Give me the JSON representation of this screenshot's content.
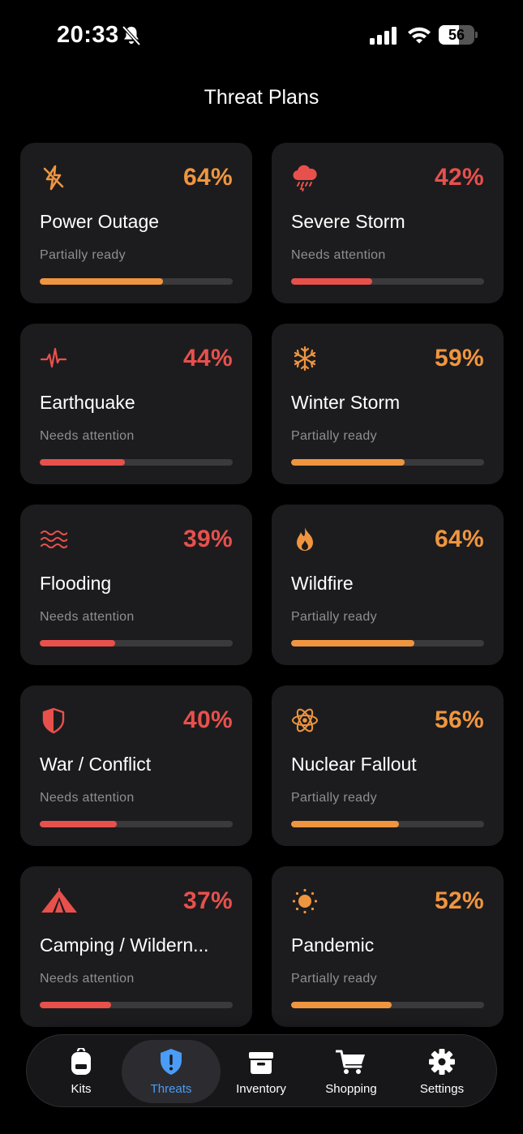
{
  "status_bar": {
    "time": "20:33",
    "battery": "56",
    "battery_level": 0.56
  },
  "page": {
    "title": "Threat Plans"
  },
  "colors": {
    "orange": "#f0953f",
    "red": "#e8504c",
    "active_tab": "#4a9cf6"
  },
  "threats": [
    {
      "icon": "lightning-slash-icon",
      "name": "Power Outage",
      "percent": "64%",
      "level": 0.64,
      "status": "Partially ready",
      "color": "orange"
    },
    {
      "icon": "cloud-storm-icon",
      "name": "Severe Storm",
      "percent": "42%",
      "level": 0.42,
      "status": "Needs attention",
      "color": "red"
    },
    {
      "icon": "waveform-icon",
      "name": "Earthquake",
      "percent": "44%",
      "level": 0.44,
      "status": "Needs attention",
      "color": "red"
    },
    {
      "icon": "snowflake-icon",
      "name": "Winter Storm",
      "percent": "59%",
      "level": 0.59,
      "status": "Partially ready",
      "color": "orange"
    },
    {
      "icon": "water-waves-icon",
      "name": "Flooding",
      "percent": "39%",
      "level": 0.39,
      "status": "Needs attention",
      "color": "red"
    },
    {
      "icon": "flame-icon",
      "name": "Wildfire",
      "percent": "64%",
      "level": 0.64,
      "status": "Partially ready",
      "color": "orange"
    },
    {
      "icon": "shield-icon",
      "name": "War / Conflict",
      "percent": "40%",
      "level": 0.4,
      "status": "Needs attention",
      "color": "red"
    },
    {
      "icon": "atom-icon",
      "name": "Nuclear Fallout",
      "percent": "56%",
      "level": 0.56,
      "status": "Partially ready",
      "color": "orange"
    },
    {
      "icon": "tent-icon",
      "name": "Camping / Wildern...",
      "percent": "37%",
      "level": 0.37,
      "status": "Needs attention",
      "color": "red"
    },
    {
      "icon": "sun-icon",
      "name": "Pandemic",
      "percent": "52%",
      "level": 0.52,
      "status": "Partially ready",
      "color": "orange"
    }
  ],
  "tabs": [
    {
      "icon": "backpack-icon",
      "label": "Kits",
      "active": false
    },
    {
      "icon": "shield-exclamation-icon",
      "label": "Threats",
      "active": true
    },
    {
      "icon": "archive-box-icon",
      "label": "Inventory",
      "active": false
    },
    {
      "icon": "cart-icon",
      "label": "Shopping",
      "active": false
    },
    {
      "icon": "gear-icon",
      "label": "Settings",
      "active": false
    }
  ]
}
